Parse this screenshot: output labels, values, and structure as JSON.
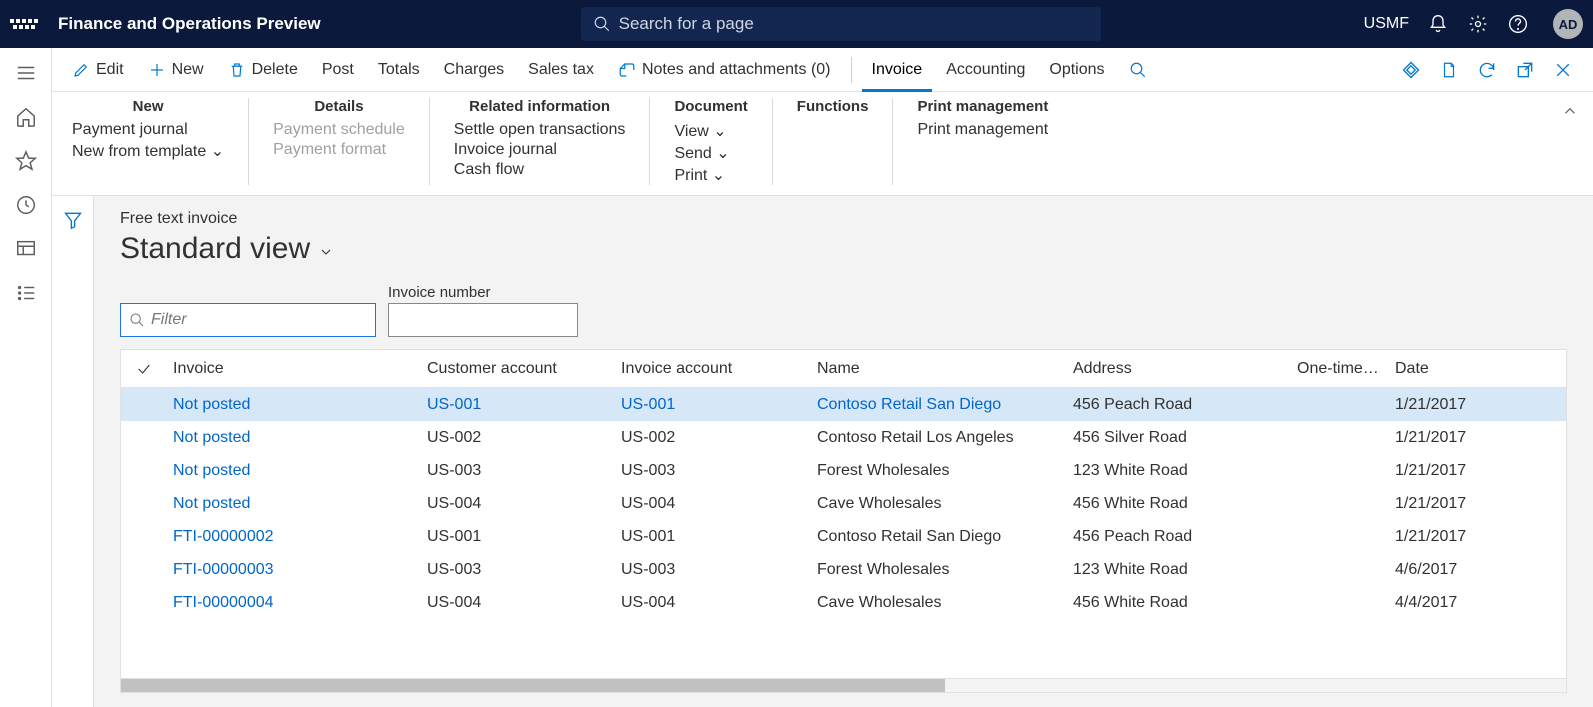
{
  "topbar": {
    "app_title": "Finance and Operations Preview",
    "search_placeholder": "Search for a page",
    "company": "USMF",
    "avatar": "AD"
  },
  "cmdbar": {
    "edit": "Edit",
    "new": "New",
    "delete": "Delete",
    "post": "Post",
    "totals": "Totals",
    "charges": "Charges",
    "salestax": "Sales tax",
    "notes": "Notes and attachments (0)",
    "invoice": "Invoice",
    "accounting": "Accounting",
    "options": "Options"
  },
  "ribbon": {
    "groups": [
      {
        "title": "New",
        "items": [
          "Payment journal",
          "New from template ⌄"
        ]
      },
      {
        "title": "Details",
        "items_disabled": [
          "Payment schedule",
          "Payment format"
        ]
      },
      {
        "title": "Related information",
        "items": [
          "Settle open transactions",
          "Invoice journal",
          "Cash flow"
        ]
      },
      {
        "title": "Document",
        "items": [
          "View ⌄",
          "Send ⌄",
          "Print ⌄"
        ]
      },
      {
        "title": "Functions",
        "items": []
      },
      {
        "title": "Print management",
        "items": [
          "Print management"
        ]
      }
    ]
  },
  "page": {
    "subtitle": "Free text invoice",
    "title": "Standard view",
    "filter_placeholder": "Filter",
    "invno_label": "Invoice number"
  },
  "grid": {
    "columns": [
      "Invoice",
      "Customer account",
      "Invoice account",
      "Name",
      "Address",
      "One-time cus…",
      "Date"
    ],
    "rows": [
      {
        "invoice": "Not posted",
        "cust": "US-001",
        "iacc": "US-001",
        "name": "Contoso Retail San Diego",
        "addr": "456 Peach Road",
        "date": "1/21/2017",
        "selected": true,
        "linked_cust": true,
        "linked_name": true
      },
      {
        "invoice": "Not posted",
        "cust": "US-002",
        "iacc": "US-002",
        "name": "Contoso Retail Los Angeles",
        "addr": "456 Silver Road",
        "date": "1/21/2017"
      },
      {
        "invoice": "Not posted",
        "cust": "US-003",
        "iacc": "US-003",
        "name": "Forest Wholesales",
        "addr": "123 White Road",
        "date": "1/21/2017"
      },
      {
        "invoice": "Not posted",
        "cust": "US-004",
        "iacc": "US-004",
        "name": "Cave Wholesales",
        "addr": "456 White Road",
        "date": "1/21/2017"
      },
      {
        "invoice": "FTI-00000002",
        "cust": "US-001",
        "iacc": "US-001",
        "name": "Contoso Retail San Diego",
        "addr": "456 Peach Road",
        "date": "1/21/2017"
      },
      {
        "invoice": "FTI-00000003",
        "cust": "US-003",
        "iacc": "US-003",
        "name": "Forest Wholesales",
        "addr": "123 White Road",
        "date": "4/6/2017"
      },
      {
        "invoice": "FTI-00000004",
        "cust": "US-004",
        "iacc": "US-004",
        "name": "Cave Wholesales",
        "addr": "456 White Road",
        "date": "4/4/2017"
      }
    ]
  }
}
